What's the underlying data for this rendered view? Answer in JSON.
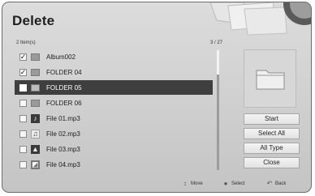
{
  "dialog": {
    "title": "Delete",
    "item_count": "2 Item(s)",
    "page_indicator": "3 / 27"
  },
  "items": [
    {
      "name": "Album002",
      "checked": "✓",
      "icon": "folder-icon",
      "thumb": ""
    },
    {
      "name": "FOLDER 04",
      "checked": "✓",
      "icon": "folder-icon",
      "thumb": ""
    },
    {
      "name": "FOLDER 05",
      "checked": "",
      "icon": "folder-icon",
      "thumb": ""
    },
    {
      "name": "FOLDER 06",
      "checked": "",
      "icon": "folder-icon",
      "thumb": ""
    },
    {
      "name": "File 01.mp3",
      "checked": "",
      "icon": "album-art-icon",
      "thumb": "♪"
    },
    {
      "name": "File 02.mp3",
      "checked": "",
      "icon": "music-file-icon",
      "thumb": "♫"
    },
    {
      "name": "File 03.mp3",
      "checked": "",
      "icon": "album-art-icon",
      "thumb": "▲"
    },
    {
      "name": "File 04.mp3",
      "checked": "",
      "icon": "picture-icon",
      "thumb": "◩"
    }
  ],
  "buttons": {
    "start": "Start",
    "select_all": "Select All",
    "all_type": "All Type",
    "close": "Close"
  },
  "footer": {
    "move": "Move",
    "select": "Select",
    "back": "Back",
    "move_icon": "↕",
    "select_icon": "●",
    "back_icon": "↶"
  },
  "colors": {
    "highlight": "#3f3f3f",
    "background": "#d4d4d4"
  }
}
